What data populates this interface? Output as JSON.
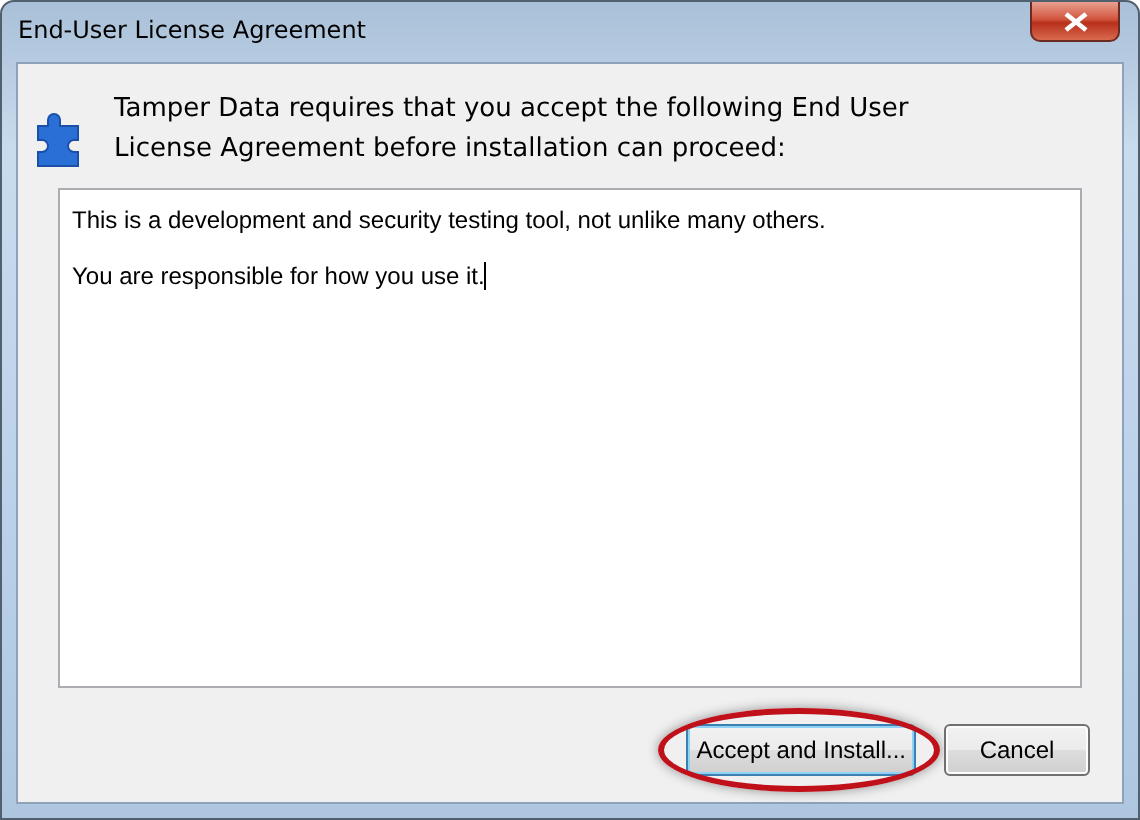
{
  "window": {
    "title": "End-User License Agreement"
  },
  "message": "Tamper Data requires that you accept the following End User License Agreement before installation can proceed:",
  "license_text": {
    "paragraphs": [
      "This is a development and security testing tool, not unlike many others.",
      "You are responsible for how you use it."
    ],
    "focused": true
  },
  "buttons": [
    {
      "label": "Accept and Install...",
      "highlighted": true,
      "focused": true
    },
    {
      "label": "Cancel",
      "highlighted": false,
      "focused": false
    }
  ]
}
